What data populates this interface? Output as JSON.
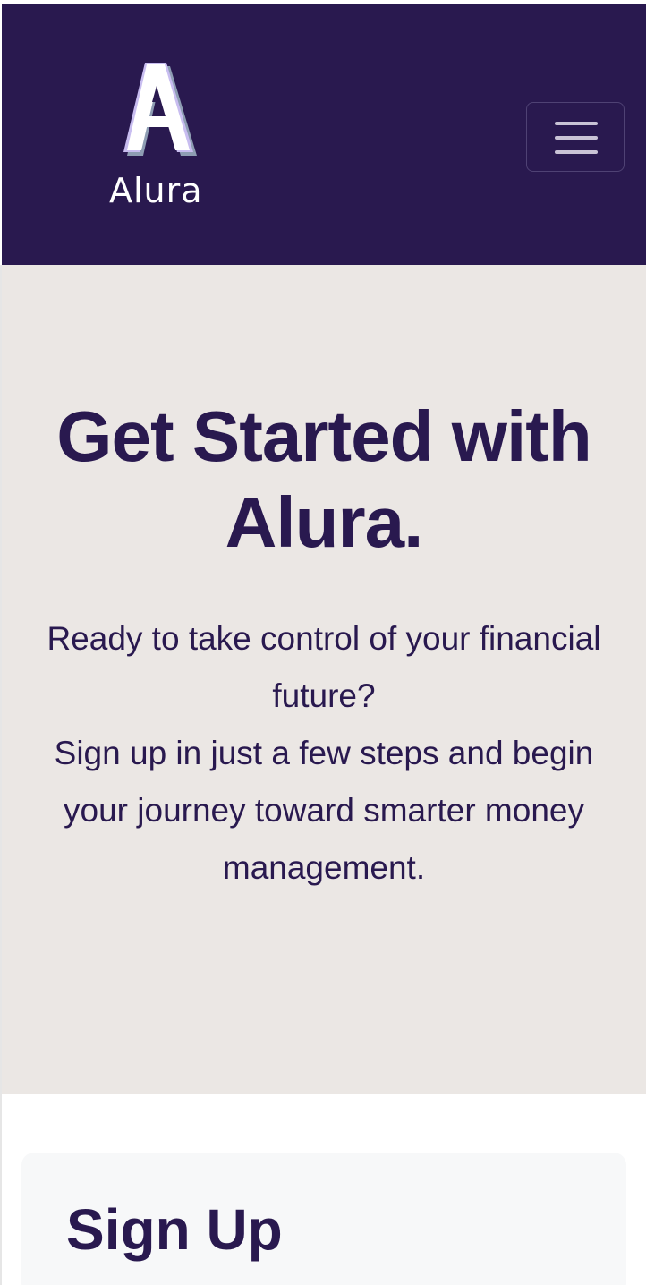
{
  "navbar": {
    "brand_name": "Alura",
    "logo_icon": "alura-a-logo",
    "menu_icon": "hamburger-menu-icon",
    "background_color": "#29194f"
  },
  "hero": {
    "title": "Get Started with Alura.",
    "line_1": "Ready to take control of your financial future?",
    "line_2": "Sign up in just a few steps and begin your journey toward smarter money management.",
    "background_color": "#ebe7e4",
    "text_color": "#29194f"
  },
  "signup": {
    "title": "Sign Up"
  }
}
